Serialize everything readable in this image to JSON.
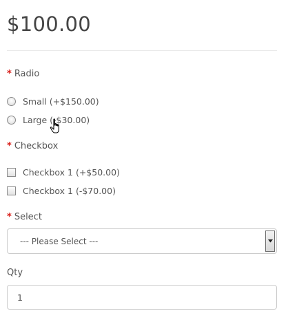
{
  "product": {
    "price": "$100.00"
  },
  "options": {
    "radio": {
      "label": "Radio",
      "required_mark": "*",
      "items": [
        {
          "label": "Small (+$150.00)"
        },
        {
          "label": "Large (-$30.00)"
        }
      ]
    },
    "checkbox": {
      "label": "Checkbox",
      "required_mark": "*",
      "items": [
        {
          "label": "Checkbox 1 (+$50.00)"
        },
        {
          "label": "Checkbox 1 (-$70.00)"
        }
      ]
    },
    "select": {
      "label": "Select",
      "required_mark": "*",
      "selected_value": "--- Please Select ---"
    }
  },
  "qty": {
    "label": "Qty",
    "value": "1"
  },
  "icons": {
    "select_arrow": "chevron-down-icon",
    "cursor": "hand-pointer-icon"
  },
  "colors": {
    "required": "#d9231e",
    "text": "#555555",
    "price": "#444444"
  }
}
